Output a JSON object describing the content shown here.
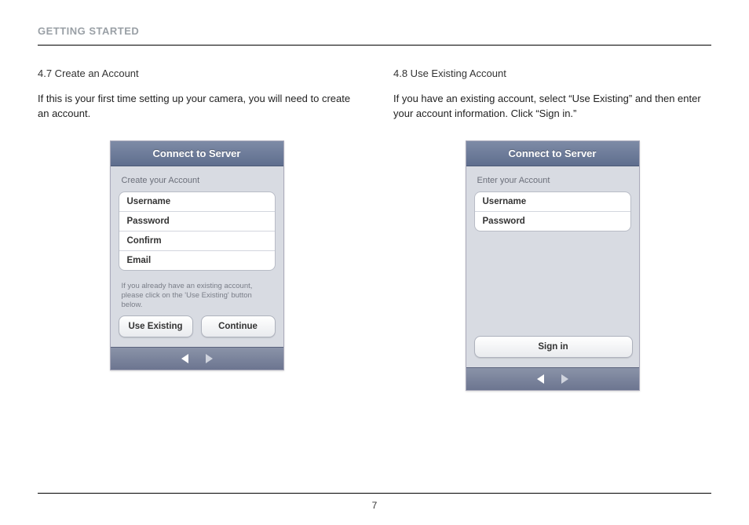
{
  "header": {
    "section_title": "GETTING STARTED"
  },
  "left": {
    "heading": "4.7 Create an Account",
    "body": "If this is your first time setting up your camera, you will need to create an account.",
    "phone": {
      "title": "Connect to Server",
      "subtitle": "Create your Account",
      "fields": [
        "Username",
        "Password",
        "Confirm",
        "Email"
      ],
      "note": "If you already have an existing account, please click on the 'Use Existing' button below.",
      "buttons": {
        "left": "Use Existing",
        "right": "Continue"
      }
    }
  },
  "right": {
    "heading": "4.8 Use Existing Account",
    "body": "If you have an existing account, select “Use Existing” and then enter your account information. Click “Sign in.”",
    "phone": {
      "title": "Connect to Server",
      "subtitle": "Enter your Account",
      "fields": [
        "Username",
        "Password"
      ],
      "button": "Sign in"
    }
  },
  "page_number": "7"
}
